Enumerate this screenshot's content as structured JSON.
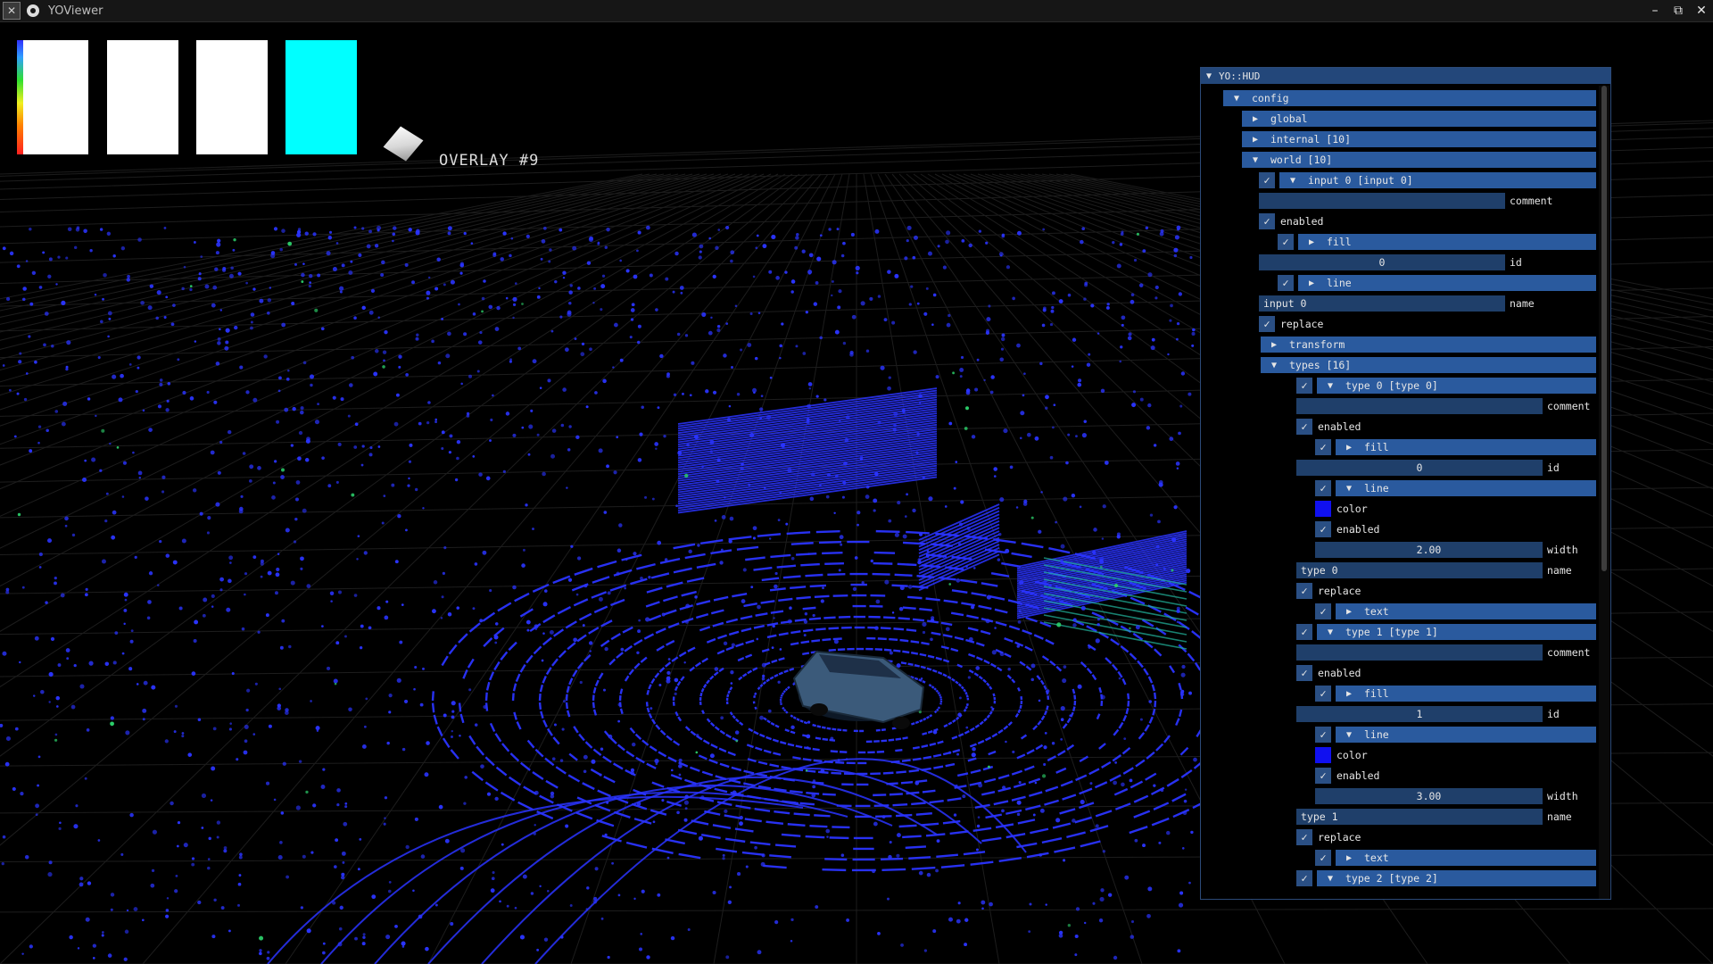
{
  "window": {
    "title": "YOViewer",
    "app_icon": "x-icon",
    "buttons": {
      "minimize": "–",
      "maximize": "⧉",
      "close": "✕"
    }
  },
  "viewport": {
    "overlay_label": "OVERLAY #9",
    "swatches": [
      {
        "name": "colormap-ramp",
        "color": "#ffffff"
      },
      {
        "name": "white",
        "color": "#ffffff"
      },
      {
        "name": "white",
        "color": "#ffffff"
      },
      {
        "name": "cyan",
        "color": "#00ffff"
      }
    ],
    "point_cloud_color": "#2a34ff",
    "accent_colors": {
      "green": "#2ccf6a",
      "teal": "#22b8a0"
    }
  },
  "hud": {
    "title": "YO::HUD",
    "rows": [
      {
        "kind": "bar",
        "indent": 0,
        "arrow": "▼",
        "label": "config"
      },
      {
        "kind": "bar",
        "indent": 1,
        "arrow": "▶",
        "label": "global"
      },
      {
        "kind": "bar",
        "indent": 1,
        "arrow": "▶",
        "label": "internal [10]"
      },
      {
        "kind": "bar",
        "indent": 1,
        "arrow": "▼",
        "label": "world [10]"
      },
      {
        "kind": "checkbar",
        "indent": 2,
        "arrow": "▼",
        "label": "input 0 [input 0]"
      },
      {
        "kind": "field",
        "indent": 2,
        "value": "",
        "label": "comment"
      },
      {
        "kind": "check",
        "indent": 2,
        "label": "enabled"
      },
      {
        "kind": "checkbar",
        "indent": 3,
        "arrow": "▶",
        "label": "fill"
      },
      {
        "kind": "field",
        "indent": 2,
        "align": "center",
        "value": "0",
        "label": "id"
      },
      {
        "kind": "checkbar",
        "indent": 3,
        "arrow": "▶",
        "label": "line"
      },
      {
        "kind": "field",
        "indent": 2,
        "align": "left",
        "value": "input 0",
        "label": "name"
      },
      {
        "kind": "check",
        "indent": 2,
        "label": "replace"
      },
      {
        "kind": "bar",
        "indent": 2,
        "arrow": "▶",
        "label": "transform"
      },
      {
        "kind": "bar",
        "indent": 2,
        "arrow": "▼",
        "label": "types [16]"
      },
      {
        "kind": "checkbar",
        "indent": 4,
        "arrow": "▼",
        "label": "type 0 [type 0]"
      },
      {
        "kind": "field",
        "indent": 4,
        "value": "",
        "label": "comment"
      },
      {
        "kind": "check",
        "indent": 4,
        "label": "enabled"
      },
      {
        "kind": "checkbar",
        "indent": 5,
        "arrow": "▶",
        "label": "fill"
      },
      {
        "kind": "field",
        "indent": 4,
        "align": "center",
        "value": "0",
        "label": "id"
      },
      {
        "kind": "checkbar",
        "indent": 5,
        "arrow": "▼",
        "label": "line"
      },
      {
        "kind": "color",
        "indent": 5,
        "color": "#1010f0",
        "label": "color"
      },
      {
        "kind": "check",
        "indent": 5,
        "label": "enabled"
      },
      {
        "kind": "field",
        "indent": 5,
        "align": "center",
        "value": "2.00",
        "label": "width"
      },
      {
        "kind": "field",
        "indent": 4,
        "align": "left",
        "value": "type 0",
        "label": "name"
      },
      {
        "kind": "check",
        "indent": 4,
        "label": "replace"
      },
      {
        "kind": "checkbar",
        "indent": 5,
        "arrow": "▶",
        "label": "text"
      },
      {
        "kind": "checkbar",
        "indent": 4,
        "arrow": "▼",
        "label": "type 1 [type 1]"
      },
      {
        "kind": "field",
        "indent": 4,
        "value": "",
        "label": "comment"
      },
      {
        "kind": "check",
        "indent": 4,
        "label": "enabled"
      },
      {
        "kind": "checkbar",
        "indent": 5,
        "arrow": "▶",
        "label": "fill"
      },
      {
        "kind": "field",
        "indent": 4,
        "align": "center",
        "value": "1",
        "label": "id"
      },
      {
        "kind": "checkbar",
        "indent": 5,
        "arrow": "▼",
        "label": "line"
      },
      {
        "kind": "color",
        "indent": 5,
        "color": "#1010f0",
        "label": "color"
      },
      {
        "kind": "check",
        "indent": 5,
        "label": "enabled"
      },
      {
        "kind": "field",
        "indent": 5,
        "align": "center",
        "value": "3.00",
        "label": "width"
      },
      {
        "kind": "field",
        "indent": 4,
        "align": "left",
        "value": "type 1",
        "label": "name"
      },
      {
        "kind": "check",
        "indent": 4,
        "label": "replace"
      },
      {
        "kind": "checkbar",
        "indent": 5,
        "arrow": "▶",
        "label": "text"
      },
      {
        "kind": "checkbar",
        "indent": 4,
        "arrow": "▼",
        "label": "type 2 [type 2]"
      }
    ]
  }
}
